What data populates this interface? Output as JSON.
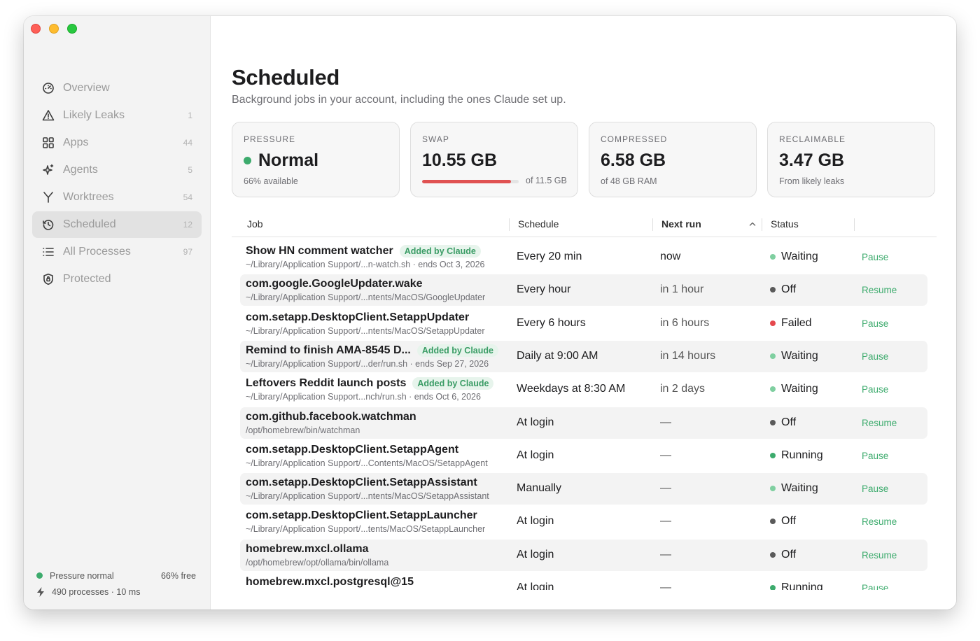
{
  "sidebar": {
    "items": [
      {
        "label": "Overview",
        "count": "",
        "icon": "gauge-icon"
      },
      {
        "label": "Likely Leaks",
        "count": "1",
        "icon": "warning-icon"
      },
      {
        "label": "Apps",
        "count": "44",
        "icon": "grid-icon"
      },
      {
        "label": "Agents",
        "count": "5",
        "icon": "sparkle-icon"
      },
      {
        "label": "Worktrees",
        "count": "54",
        "icon": "branch-icon"
      },
      {
        "label": "Scheduled",
        "count": "12",
        "icon": "clock-history-icon",
        "active": true
      },
      {
        "label": "All Processes",
        "count": "97",
        "icon": "list-icon"
      },
      {
        "label": "Protected",
        "count": "",
        "icon": "shield-icon"
      }
    ],
    "footer": {
      "pressure": "Pressure normal",
      "free": "66% free",
      "processes": "490 processes · 10 ms"
    }
  },
  "main": {
    "title": "Scheduled",
    "subtitle": "Background jobs in your account, including the ones Claude set up."
  },
  "cards": {
    "pressure": {
      "label": "PRESSURE",
      "value": "Normal",
      "sub": "66% available"
    },
    "swap": {
      "label": "SWAP",
      "value": "10.55 GB",
      "sub": "of 11.5 GB",
      "used_fraction": 0.92
    },
    "compressed": {
      "label": "COMPRESSED",
      "value": "6.58 GB",
      "sub": "of 48 GB RAM"
    },
    "reclaimable": {
      "label": "RECLAIMABLE",
      "value": "3.47 GB",
      "sub": "From likely leaks"
    }
  },
  "table": {
    "columns": {
      "job": "Job",
      "schedule": "Schedule",
      "next_run": "Next run",
      "status": "Status"
    },
    "badge_text": "Added by Claude",
    "rows": [
      {
        "name": "Show HN comment watcher",
        "badge": true,
        "path": "~/Library/Application Support/...n-watch.sh · ends Oct 3, 2026",
        "schedule": "Every 20 min",
        "next": "now",
        "status": "Waiting",
        "action": "Pause"
      },
      {
        "name": "com.google.GoogleUpdater.wake",
        "badge": false,
        "path": "~/Library/Application Support/...ntents/MacOS/GoogleUpdater",
        "schedule": "Every hour",
        "next": "in 1 hour",
        "status": "Off",
        "action": "Resume"
      },
      {
        "name": "com.setapp.DesktopClient.SetappUpdater",
        "badge": false,
        "path": "~/Library/Application Support/...ntents/MacOS/SetappUpdater",
        "schedule": "Every 6 hours",
        "next": "in 6 hours",
        "status": "Failed",
        "action": "Pause"
      },
      {
        "name": "Remind to finish AMA-8545 D...",
        "badge": true,
        "path": "~/Library/Application Support/...der/run.sh · ends Sep 27, 2026",
        "schedule": "Daily at 9:00 AM",
        "next": "in 14 hours",
        "status": "Waiting",
        "action": "Pause"
      },
      {
        "name": "Leftovers Reddit launch posts",
        "badge": true,
        "path": "~/Library/Application Support...nch/run.sh · ends Oct 6, 2026",
        "schedule": "Weekdays at 8:30 AM",
        "next": "in 2 days",
        "status": "Waiting",
        "action": "Pause"
      },
      {
        "name": "com.github.facebook.watchman",
        "badge": false,
        "path": "/opt/homebrew/bin/watchman",
        "schedule": "At login",
        "next": "—",
        "status": "Off",
        "action": "Resume"
      },
      {
        "name": "com.setapp.DesktopClient.SetappAgent",
        "badge": false,
        "path": "~/Library/Application Support/...Contents/MacOS/SetappAgent",
        "schedule": "At login",
        "next": "—",
        "status": "Running",
        "action": "Pause"
      },
      {
        "name": "com.setapp.DesktopClient.SetappAssistant",
        "badge": false,
        "path": "~/Library/Application Support/...ntents/MacOS/SetappAssistant",
        "schedule": "Manually",
        "next": "—",
        "status": "Waiting",
        "action": "Pause"
      },
      {
        "name": "com.setapp.DesktopClient.SetappLauncher",
        "badge": false,
        "path": "~/Library/Application Support/...tents/MacOS/SetappLauncher",
        "schedule": "At login",
        "next": "—",
        "status": "Off",
        "action": "Resume"
      },
      {
        "name": "homebrew.mxcl.ollama",
        "badge": false,
        "path": "/opt/homebrew/opt/ollama/bin/ollama",
        "schedule": "At login",
        "next": "—",
        "status": "Off",
        "action": "Resume"
      },
      {
        "name": "homebrew.mxcl.postgresql@15",
        "badge": false,
        "path": "",
        "schedule": "At login",
        "next": "—",
        "status": "Running",
        "action": "Pause"
      }
    ]
  },
  "colors": {
    "accent_green": "#3dab6d",
    "waiting": "#7fcfa0",
    "running": "#3dab6d",
    "off": "#5a5a5a",
    "failed": "#e5484d",
    "next_now": "#1d1d1f",
    "next_muted": "#555555"
  }
}
